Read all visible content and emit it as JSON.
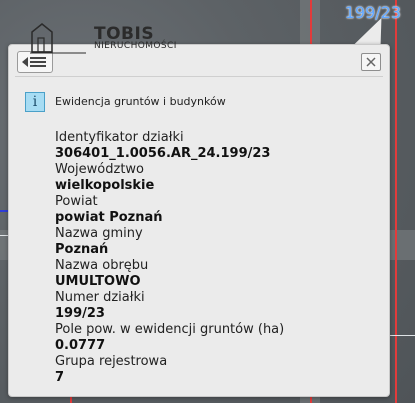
{
  "map": {
    "parcel_label": "199/23"
  },
  "logo": {
    "title": "TOBIS",
    "subtitle": "NIERUCHOMOŚCI"
  },
  "popup": {
    "section_title": "Ewidencja gruntów i budynków",
    "info_icon_glyph": "i",
    "fields": [
      {
        "label": "Identyfikator działki",
        "value": "306401_1.0056.AR_24.199/23"
      },
      {
        "label": "Województwo",
        "value": "wielkopolskie"
      },
      {
        "label": "Powiat",
        "value": "powiat Poznań"
      },
      {
        "label": "Nazwa gminy",
        "value": "Poznań"
      },
      {
        "label": "Nazwa obrębu",
        "value": "UMULTOWO"
      },
      {
        "label": "Numer działki",
        "value": "199/23"
      },
      {
        "label": "Pole pow. w ewidencji gruntów (ha)",
        "value": "0.0777"
      },
      {
        "label": "Grupa rejestrowa",
        "value": "7"
      }
    ]
  },
  "colors": {
    "popup_bg": "#ebebeb",
    "parcel_label": "#5fa6ff",
    "parcel_boundary": "#e23b3b",
    "info_icon_bg": "#a7dcf3"
  }
}
